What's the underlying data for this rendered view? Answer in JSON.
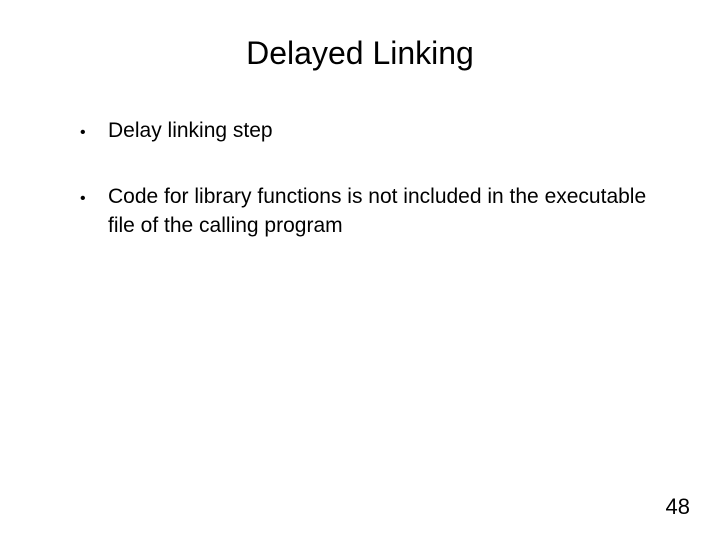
{
  "slide": {
    "title": "Delayed Linking",
    "bullets": [
      "Delay linking step",
      "Code for library functions is not included in the executable file of the calling program"
    ],
    "page_number": "48"
  }
}
